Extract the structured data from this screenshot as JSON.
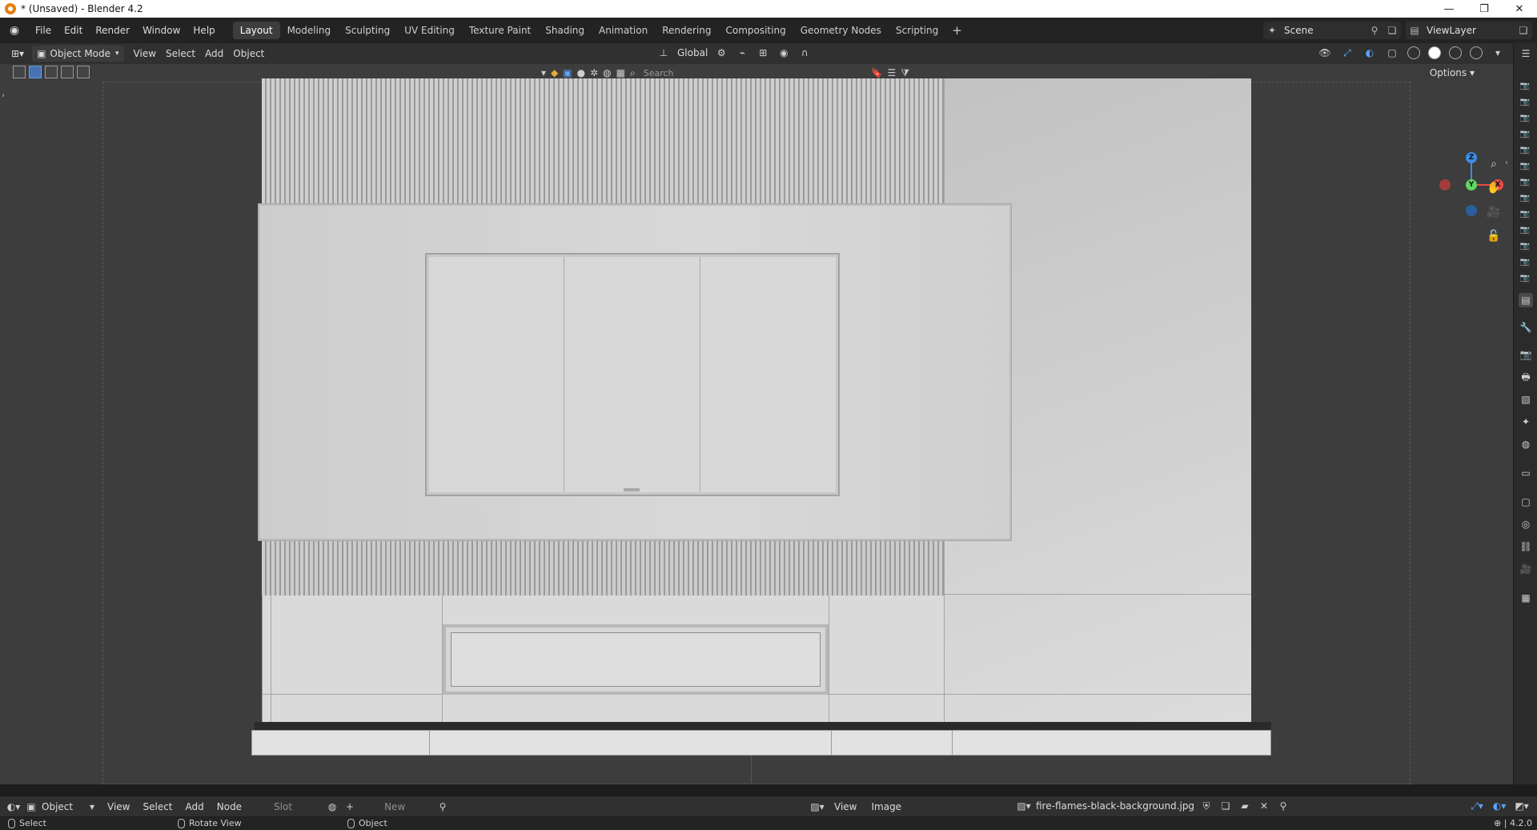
{
  "window": {
    "title": "* (Unsaved) - Blender 4.2",
    "minimize": "—",
    "maximize": "❐",
    "close": "✕"
  },
  "menu": {
    "items": [
      "File",
      "Edit",
      "Render",
      "Window",
      "Help"
    ]
  },
  "workspaces": {
    "tabs": [
      "Layout",
      "Modeling",
      "Sculpting",
      "UV Editing",
      "Texture Paint",
      "Shading",
      "Animation",
      "Rendering",
      "Compositing",
      "Geometry Nodes",
      "Scripting"
    ],
    "active": "Layout",
    "add": "+"
  },
  "scene": {
    "label": "Scene"
  },
  "view_layer": {
    "label": "ViewLayer"
  },
  "viewport_header": {
    "mode": "Object Mode",
    "menus": [
      "View",
      "Select",
      "Add",
      "Object"
    ],
    "transform_orientation": "Global"
  },
  "tool_header": {
    "search_placeholder": "Search",
    "options_label": "Options"
  },
  "gizmo": {
    "z": "Z",
    "y": "Y",
    "x": "X",
    "colors": {
      "x": "#e84b4b",
      "y": "#5fd65f",
      "z": "#3d8ce3",
      "neg": "#a33d3d"
    }
  },
  "bottom_header": {
    "editor_left": "Object",
    "menus_left": [
      "View",
      "Select",
      "Add",
      "Node"
    ],
    "slot": "Slot",
    "new": "New",
    "menus_image": [
      "View",
      "Image"
    ],
    "image_name": "fire-flames-black-background.jpg"
  },
  "statusbar": {
    "select": "Select",
    "rotate": "Rotate View",
    "object": "Object",
    "version": "4.2.0"
  }
}
